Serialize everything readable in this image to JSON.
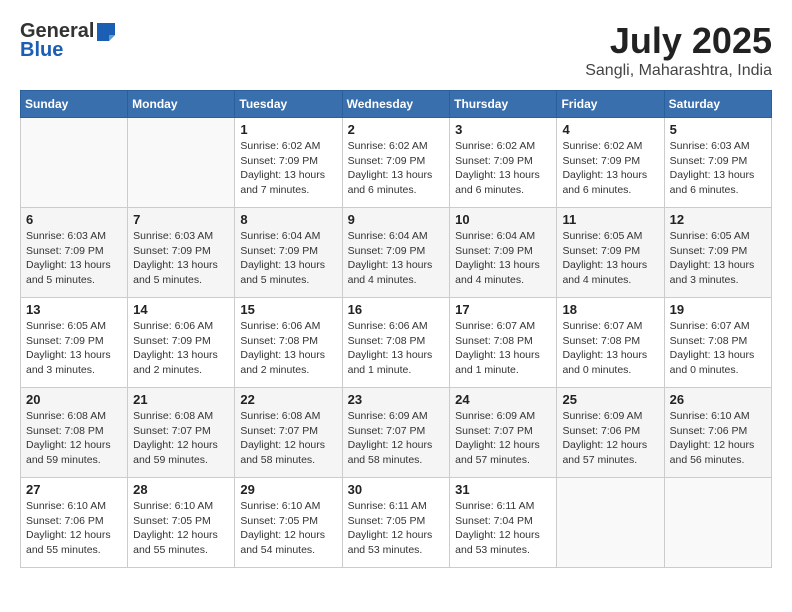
{
  "header": {
    "logo_general": "General",
    "logo_blue": "Blue",
    "month_year": "July 2025",
    "location": "Sangli, Maharashtra, India"
  },
  "days_of_week": [
    "Sunday",
    "Monday",
    "Tuesday",
    "Wednesday",
    "Thursday",
    "Friday",
    "Saturday"
  ],
  "weeks": [
    [
      {
        "num": "",
        "info": ""
      },
      {
        "num": "",
        "info": ""
      },
      {
        "num": "1",
        "info": "Sunrise: 6:02 AM\nSunset: 7:09 PM\nDaylight: 13 hours and 7 minutes."
      },
      {
        "num": "2",
        "info": "Sunrise: 6:02 AM\nSunset: 7:09 PM\nDaylight: 13 hours and 6 minutes."
      },
      {
        "num": "3",
        "info": "Sunrise: 6:02 AM\nSunset: 7:09 PM\nDaylight: 13 hours and 6 minutes."
      },
      {
        "num": "4",
        "info": "Sunrise: 6:02 AM\nSunset: 7:09 PM\nDaylight: 13 hours and 6 minutes."
      },
      {
        "num": "5",
        "info": "Sunrise: 6:03 AM\nSunset: 7:09 PM\nDaylight: 13 hours and 6 minutes."
      }
    ],
    [
      {
        "num": "6",
        "info": "Sunrise: 6:03 AM\nSunset: 7:09 PM\nDaylight: 13 hours and 5 minutes."
      },
      {
        "num": "7",
        "info": "Sunrise: 6:03 AM\nSunset: 7:09 PM\nDaylight: 13 hours and 5 minutes."
      },
      {
        "num": "8",
        "info": "Sunrise: 6:04 AM\nSunset: 7:09 PM\nDaylight: 13 hours and 5 minutes."
      },
      {
        "num": "9",
        "info": "Sunrise: 6:04 AM\nSunset: 7:09 PM\nDaylight: 13 hours and 4 minutes."
      },
      {
        "num": "10",
        "info": "Sunrise: 6:04 AM\nSunset: 7:09 PM\nDaylight: 13 hours and 4 minutes."
      },
      {
        "num": "11",
        "info": "Sunrise: 6:05 AM\nSunset: 7:09 PM\nDaylight: 13 hours and 4 minutes."
      },
      {
        "num": "12",
        "info": "Sunrise: 6:05 AM\nSunset: 7:09 PM\nDaylight: 13 hours and 3 minutes."
      }
    ],
    [
      {
        "num": "13",
        "info": "Sunrise: 6:05 AM\nSunset: 7:09 PM\nDaylight: 13 hours and 3 minutes."
      },
      {
        "num": "14",
        "info": "Sunrise: 6:06 AM\nSunset: 7:09 PM\nDaylight: 13 hours and 2 minutes."
      },
      {
        "num": "15",
        "info": "Sunrise: 6:06 AM\nSunset: 7:08 PM\nDaylight: 13 hours and 2 minutes."
      },
      {
        "num": "16",
        "info": "Sunrise: 6:06 AM\nSunset: 7:08 PM\nDaylight: 13 hours and 1 minute."
      },
      {
        "num": "17",
        "info": "Sunrise: 6:07 AM\nSunset: 7:08 PM\nDaylight: 13 hours and 1 minute."
      },
      {
        "num": "18",
        "info": "Sunrise: 6:07 AM\nSunset: 7:08 PM\nDaylight: 13 hours and 0 minutes."
      },
      {
        "num": "19",
        "info": "Sunrise: 6:07 AM\nSunset: 7:08 PM\nDaylight: 13 hours and 0 minutes."
      }
    ],
    [
      {
        "num": "20",
        "info": "Sunrise: 6:08 AM\nSunset: 7:08 PM\nDaylight: 12 hours and 59 minutes."
      },
      {
        "num": "21",
        "info": "Sunrise: 6:08 AM\nSunset: 7:07 PM\nDaylight: 12 hours and 59 minutes."
      },
      {
        "num": "22",
        "info": "Sunrise: 6:08 AM\nSunset: 7:07 PM\nDaylight: 12 hours and 58 minutes."
      },
      {
        "num": "23",
        "info": "Sunrise: 6:09 AM\nSunset: 7:07 PM\nDaylight: 12 hours and 58 minutes."
      },
      {
        "num": "24",
        "info": "Sunrise: 6:09 AM\nSunset: 7:07 PM\nDaylight: 12 hours and 57 minutes."
      },
      {
        "num": "25",
        "info": "Sunrise: 6:09 AM\nSunset: 7:06 PM\nDaylight: 12 hours and 57 minutes."
      },
      {
        "num": "26",
        "info": "Sunrise: 6:10 AM\nSunset: 7:06 PM\nDaylight: 12 hours and 56 minutes."
      }
    ],
    [
      {
        "num": "27",
        "info": "Sunrise: 6:10 AM\nSunset: 7:06 PM\nDaylight: 12 hours and 55 minutes."
      },
      {
        "num": "28",
        "info": "Sunrise: 6:10 AM\nSunset: 7:05 PM\nDaylight: 12 hours and 55 minutes."
      },
      {
        "num": "29",
        "info": "Sunrise: 6:10 AM\nSunset: 7:05 PM\nDaylight: 12 hours and 54 minutes."
      },
      {
        "num": "30",
        "info": "Sunrise: 6:11 AM\nSunset: 7:05 PM\nDaylight: 12 hours and 53 minutes."
      },
      {
        "num": "31",
        "info": "Sunrise: 6:11 AM\nSunset: 7:04 PM\nDaylight: 12 hours and 53 minutes."
      },
      {
        "num": "",
        "info": ""
      },
      {
        "num": "",
        "info": ""
      }
    ]
  ]
}
